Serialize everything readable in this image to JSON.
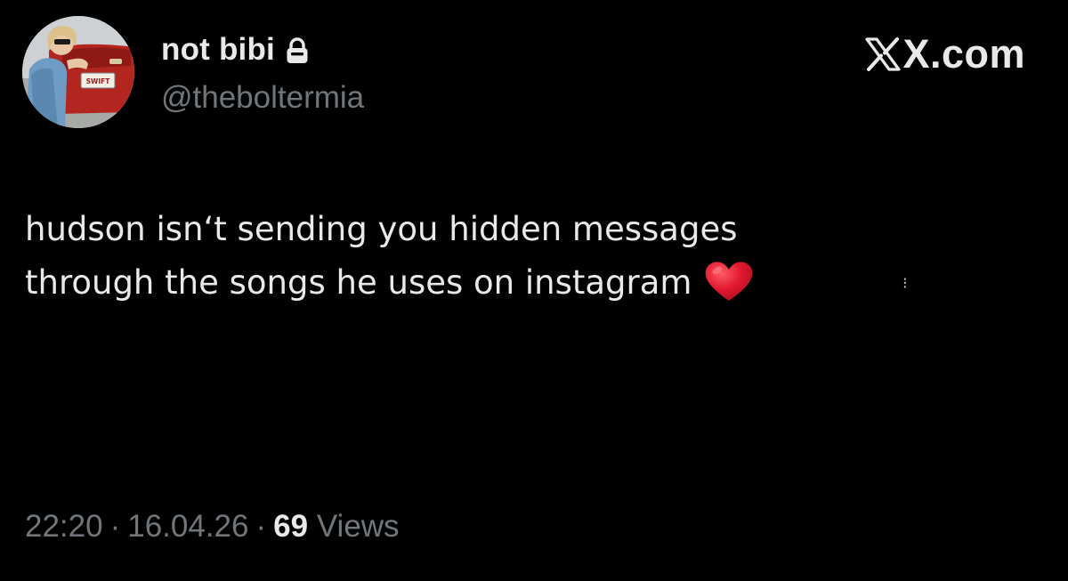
{
  "author": {
    "display_name": "not bibi",
    "handle": "@theboltermia",
    "avatar_plate_text": "SWIFT",
    "protected_icon": "lock-icon"
  },
  "brand": {
    "icon": "x-logo-icon",
    "text": "X.com"
  },
  "tweet": {
    "line_1": "hudson isn‘t sending you hidden messages",
    "line_2": "through the songs he uses on instagram",
    "emoji": "red-heart-emoji"
  },
  "meta": {
    "time": "22:20",
    "separator": "·",
    "date": "16.04.26",
    "views_count": "69",
    "views_label": "Views"
  },
  "colors": {
    "background": "#000000",
    "primary_text": "#e7e9ea",
    "secondary_text": "#71767b",
    "heart": "#e0182f"
  }
}
